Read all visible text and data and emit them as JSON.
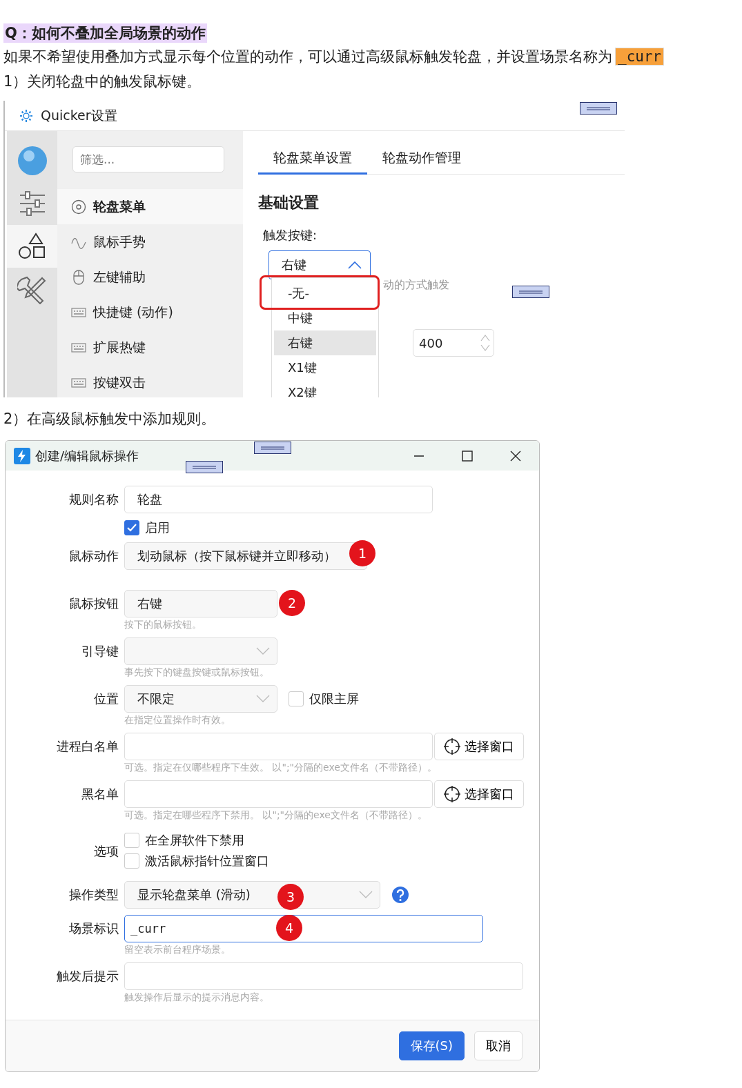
{
  "question": "Q：如何不叠加全局场景的动作",
  "intro": {
    "text": "如果不希望使用叠加方式显示每个位置的动作，可以通过高级鼠标触发轮盘，并设置场景名称为",
    "code": "_curr"
  },
  "step1": "1）关闭轮盘中的触发鼠标键。",
  "settings_window": {
    "title": "Quicker设置",
    "rail": [
      {
        "selected": false
      },
      {
        "selected": false
      },
      {
        "selected": true
      },
      {
        "selected": false
      }
    ],
    "filter": {
      "placeholder": "筛选..."
    },
    "nav": [
      {
        "label": "轮盘菜单",
        "selected": true
      },
      {
        "label": "鼠标手势",
        "selected": false
      },
      {
        "label": "左键辅助",
        "selected": false
      },
      {
        "label": "快捷键 (动作)",
        "selected": false
      },
      {
        "label": "扩展热键",
        "selected": false
      },
      {
        "label": "按键双击",
        "selected": false
      }
    ],
    "tabs": [
      {
        "label": "轮盘菜单设置",
        "selected": true
      },
      {
        "label": "轮盘动作管理",
        "selected": false
      }
    ],
    "section": "基础设置",
    "trigger_label": "触发按键:",
    "trigger_value": "右键",
    "hint_fragment": "动的方式触发",
    "number_value": "400",
    "dropdown": [
      {
        "label": "-无-",
        "hovered": false,
        "circled": true
      },
      {
        "label": "中键",
        "hovered": false,
        "circled": false
      },
      {
        "label": "右键",
        "hovered": true,
        "circled": false
      },
      {
        "label": "X1键",
        "hovered": false,
        "circled": false
      },
      {
        "label": "X2键",
        "hovered": false,
        "circled": false
      }
    ]
  },
  "step2": "2）在高级鼠标触发中添加规则。",
  "dialog": {
    "title": "创建/编辑鼠标操作",
    "rows": [
      {
        "kind": "text",
        "label": "规则名称",
        "value": "轮盘",
        "focused": false
      },
      {
        "kind": "check",
        "checked": true,
        "text": "启用"
      },
      {
        "kind": "select",
        "label": "鼠标动作",
        "value": "划动鼠标（按下鼠标键并立即移动）",
        "badge": "1"
      },
      {
        "kind": "select",
        "label": "鼠标按钮",
        "value": "右键",
        "badge": "2",
        "hint": "按下的鼠标按钮。"
      },
      {
        "kind": "select",
        "label": "引导键",
        "hint": "事先按下的键盘按键或鼠标按钮。"
      },
      {
        "kind": "select",
        "label": "位置",
        "value": "不限定",
        "extra_check": {
          "checked": false,
          "text": "仅限主屏"
        },
        "hint": "在指定位置操作时有效。"
      },
      {
        "kind": "picker",
        "label": "进程白名单",
        "button": "选择窗口",
        "hint": "可选。指定在仅哪些程序下生效。 以\";\"分隔的exe文件名（不带路径）。"
      },
      {
        "kind": "picker",
        "label": "黑名单",
        "button": "选择窗口",
        "hint": "可选。指定在哪些程序下禁用。 以\";\"分隔的exe文件名（不带路径）。"
      },
      {
        "kind": "checks",
        "label": "选项",
        "options": [
          {
            "checked": false,
            "text": "在全屏软件下禁用"
          },
          {
            "checked": false,
            "text": "激活鼠标指针位置窗口"
          }
        ]
      },
      {
        "kind": "select",
        "label": "操作类型",
        "value": "显示轮盘菜单 (滑动)",
        "badge": "3",
        "help": true
      },
      {
        "kind": "text",
        "label": "场景标识",
        "value": "_curr",
        "focused": true,
        "badge": "4",
        "hint": "留空表示前台程序场景。"
      },
      {
        "kind": "text",
        "label": "触发后提示",
        "focused": false,
        "hint": "触发操作后显示的提示消息内容。"
      }
    ],
    "buttons": [
      {
        "label": "保存(S)",
        "primary": true
      },
      {
        "label": "取消",
        "primary": false
      }
    ]
  }
}
